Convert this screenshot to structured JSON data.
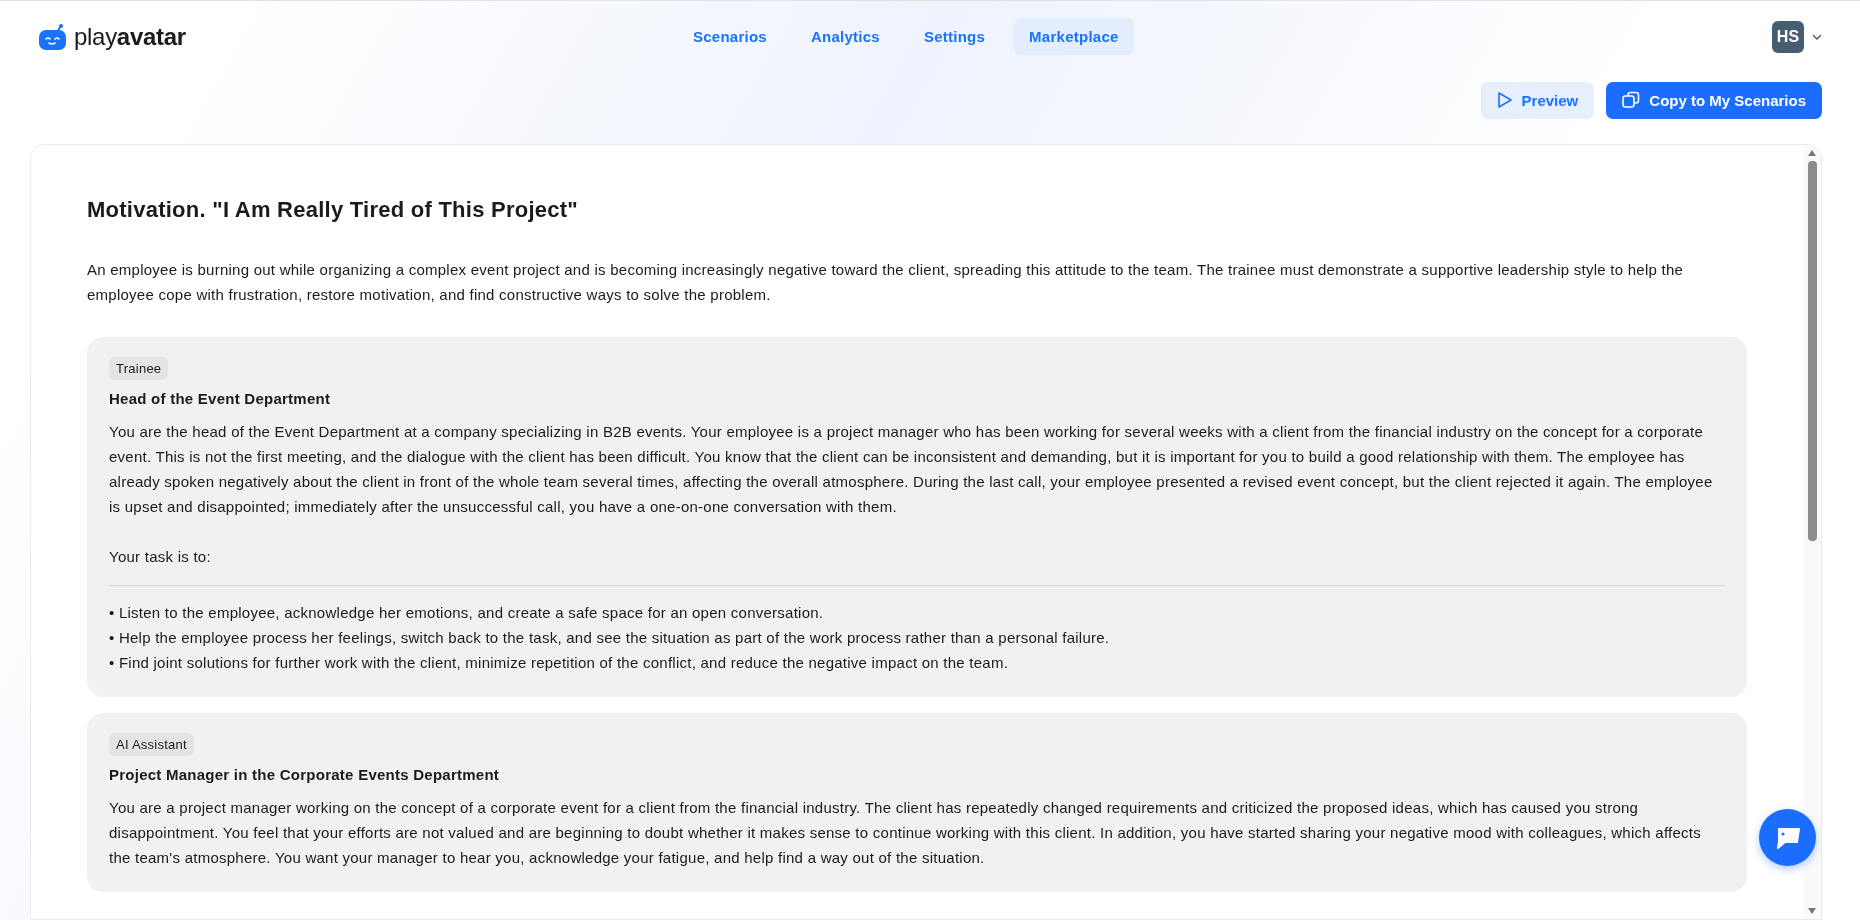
{
  "header": {
    "logo": {
      "light": "play",
      "bold": "avatar"
    },
    "nav": [
      {
        "label": "Scenarios",
        "selected": false
      },
      {
        "label": "Analytics",
        "selected": false
      },
      {
        "label": "Settings",
        "selected": false
      },
      {
        "label": "Marketplace",
        "selected": true
      }
    ],
    "user": {
      "initials": "HS"
    }
  },
  "actions": [
    {
      "kind": "preview",
      "label": "Preview"
    },
    {
      "kind": "copy",
      "label": "Copy to My Scenarios"
    }
  ],
  "scenario": {
    "title": "Motivation. \"I Am Really Tired of This Project\"",
    "description": "An employee is burning out while organizing a complex event project and is becoming increasingly negative toward the client, spreading this attitude to the team. The trainee must demonstrate a supportive leadership style to help the employee cope with frustration, restore motivation, and find constructive ways to solve the problem.",
    "roles": [
      {
        "tag": "Trainee",
        "title": "Head of the Event Department",
        "text": "You are the head of the Event Department at a company specializing in B2B events. Your employee is a project manager who has been working for several weeks with a client from the financial industry on the concept for a corporate event. This is not the first meeting, and the dialogue with the client has been difficult. You know that the client can be inconsistent and demanding, but it is important for you to build a good relationship with them. The employee has already spoken negatively about the client in front of the whole team several times, affecting the overall atmosphere. During the last call, your employee presented a revised event concept, but the client rejected it again. The employee is upset and disappointed; immediately after the unsuccessful call, you have a one-on-one conversation with them.",
        "task_intro": "Your task is to:",
        "tasks": [
          "• Listen to the employee, acknowledge her emotions, and create a safe space for an open conversation.",
          "• Help the employee process her feelings, switch back to the task, and see the situation as part of the work process rather than a personal failure.",
          "• Find joint solutions for further work with the client, minimize repetition of the conflict, and reduce the negative impact on the team."
        ]
      },
      {
        "tag": "AI Assistant",
        "title": "Project Manager in the Corporate Events Department",
        "text": "You are a project manager working on the concept of a corporate event for a client from the financial industry. The client has repeatedly changed requirements and criticized the proposed ideas, which has caused you strong disappointment. You feel that your efforts are not valued and are beginning to doubt whether it makes sense to continue working with this client. In addition, you have started sharing your negative mood with colleagues, which affects the team's atmosphere. You want your manager to hear you, acknowledge your fatigue, and help find a way out of the situation."
      }
    ]
  }
}
